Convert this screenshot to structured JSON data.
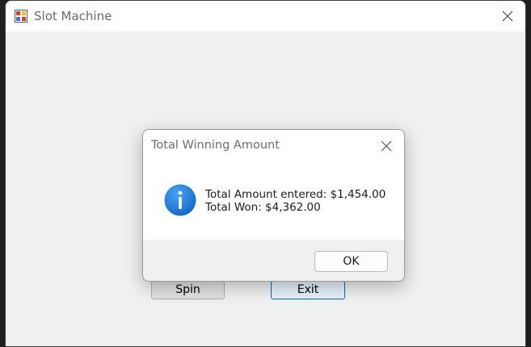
{
  "window": {
    "title": "Slot Machine",
    "app_icon": "slot-machine-app-icon",
    "close_icon": "close-icon"
  },
  "buttons": {
    "spin_label": "Spin",
    "exit_label": "Exit"
  },
  "dialog": {
    "title": "Total Winning Amount",
    "icon": "info-icon",
    "message_line1": "Total Amount entered: $1,454.00",
    "message_line2": "Total Won: $4,362.00",
    "ok_label": "OK",
    "close_icon": "close-icon"
  },
  "colors": {
    "window_bg": "#f0f0f0",
    "titlebar_bg": "#ffffff",
    "accent_blue": "#0a64c8",
    "info_icon_blue": "#1677d6"
  }
}
